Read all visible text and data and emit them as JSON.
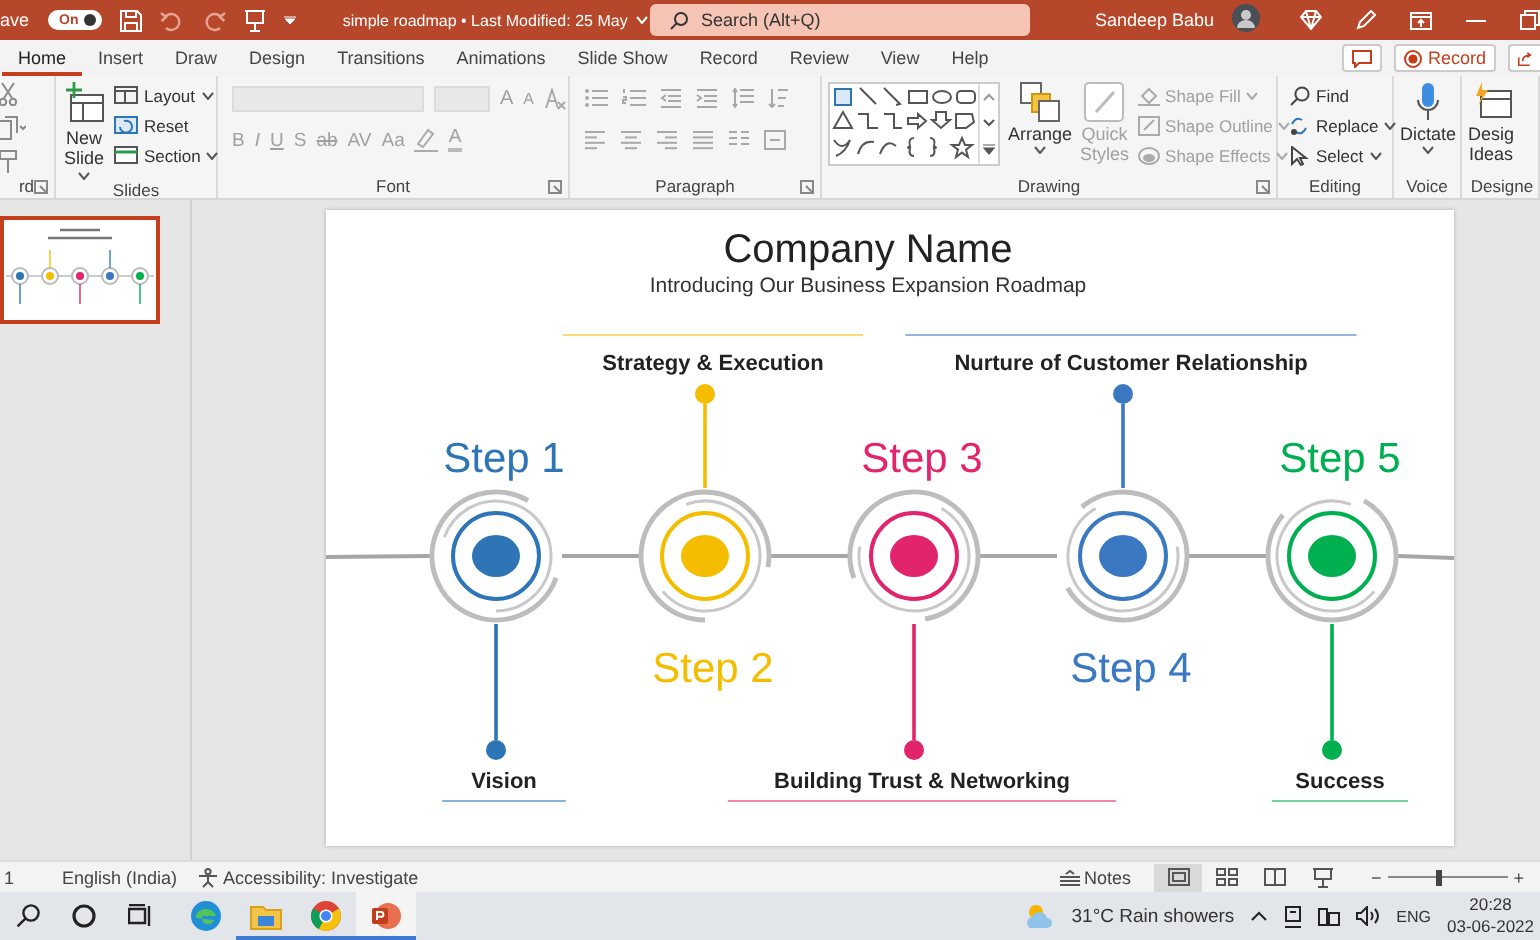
{
  "title_bar": {
    "autosave": {
      "label": "ave",
      "toggle_text": "On",
      "on": true
    },
    "title": "simple roadmap • Last Modified: 25 May",
    "search": {
      "placeholder": "Search (Alt+Q)"
    },
    "user": "Sandeep Babu"
  },
  "tabs": [
    {
      "label": "Home",
      "selected": true
    },
    {
      "label": "Insert",
      "selected": false
    },
    {
      "label": "Draw",
      "selected": false
    },
    {
      "label": "Design",
      "selected": false
    },
    {
      "label": "Transitions",
      "selected": false
    },
    {
      "label": "Animations",
      "selected": false
    },
    {
      "label": "Slide Show",
      "selected": false
    },
    {
      "label": "Record",
      "selected": false
    },
    {
      "label": "Review",
      "selected": false
    },
    {
      "label": "View",
      "selected": false
    },
    {
      "label": "Help",
      "selected": false
    }
  ],
  "record_button": "Record",
  "ribbon": {
    "groups": [
      {
        "kind": "clipboard",
        "label": "rd"
      },
      {
        "kind": "slides",
        "label": "Slides",
        "new_slide": "New Slide",
        "buttons": [
          "Layout",
          "Reset",
          "Section"
        ]
      },
      {
        "kind": "font",
        "label": "Font",
        "disabled": true,
        "size_buttons": [
          "A",
          "A"
        ],
        "format_buttons": [
          "B",
          "I",
          "U",
          "S",
          "ab",
          "AV",
          "Aa"
        ],
        "font_color": "A"
      },
      {
        "kind": "paragraph",
        "label": "Paragraph",
        "disabled": true
      },
      {
        "kind": "drawing",
        "label": "Drawing",
        "arrange": "Arrange",
        "quick_styles": {
          "label": "Quick Styles",
          "disabled": true
        },
        "shape_buttons": [
          {
            "label": "Shape Fill",
            "disabled": true
          },
          {
            "label": "Shape Outline",
            "disabled": true
          },
          {
            "label": "Shape Effects",
            "disabled": true
          }
        ]
      },
      {
        "kind": "editing",
        "label": "Editing",
        "buttons": [
          "Find",
          "Replace",
          "Select"
        ]
      },
      {
        "kind": "voice",
        "label": "Voice",
        "button": "Dictate"
      },
      {
        "kind": "designer",
        "label": "Designe",
        "button": "Desig Ideas"
      }
    ]
  },
  "slides": [
    {
      "selected": true
    }
  ],
  "slide": {
    "title": "Company Name",
    "subtitle": "Introducing Our Business Expansion Roadmap",
    "steps": [
      {
        "label": "Step 1",
        "color": "#2e75b6",
        "milestone": "Vision",
        "kind": "below"
      },
      {
        "label": "Step 2",
        "color": "#f5bd00",
        "milestone": "Strategy & Execution",
        "kind": "above"
      },
      {
        "label": "Step 3",
        "color": "#e2246c",
        "milestone": "Building Trust & Networking",
        "kind": "below"
      },
      {
        "label": "Step 4",
        "color": "#3a78c2",
        "milestone": "Nurture of Customer Relationship",
        "kind": "above"
      },
      {
        "label": "Step 5",
        "color": "#00b050",
        "milestone": "Success",
        "kind": "below"
      }
    ]
  },
  "status_bar": {
    "slide_number": "1",
    "language": "English (India)",
    "accessibility": "Accessibility: Investigate",
    "notes": "Notes",
    "views": [
      {
        "selected": true
      },
      {
        "selected": false
      },
      {
        "selected": false
      },
      {
        "selected": false
      }
    ],
    "zoom_out": "−",
    "zoom_in": "+",
    "zoom": {
      "level": 0.4
    }
  },
  "taskbar": {
    "apps": [
      {
        "running": false,
        "selected": false
      },
      {
        "running": true,
        "selected": false
      },
      {
        "running": true,
        "selected": false
      },
      {
        "running": true,
        "selected": true
      }
    ],
    "weather": "31°C  Rain showers",
    "language": "ENG",
    "time": "20:28",
    "date": "03-06-2022"
  }
}
